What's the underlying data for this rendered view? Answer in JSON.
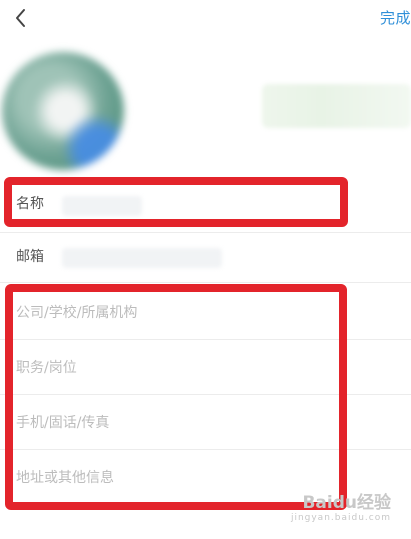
{
  "header": {
    "done_label": "完成"
  },
  "fields": {
    "name_label": "名称",
    "email_label": "邮箱"
  },
  "extra_fields": [
    {
      "placeholder": "公司/学校/所属机构"
    },
    {
      "placeholder": "职务/岗位"
    },
    {
      "placeholder": "手机/固话/传真"
    },
    {
      "placeholder": "地址或其他信息"
    }
  ],
  "watermark": {
    "text": "Baidu经验",
    "sub": "jingyan.baidu.com"
  },
  "colors": {
    "accent": "#2f8fd8",
    "highlight": "#e3242b"
  }
}
